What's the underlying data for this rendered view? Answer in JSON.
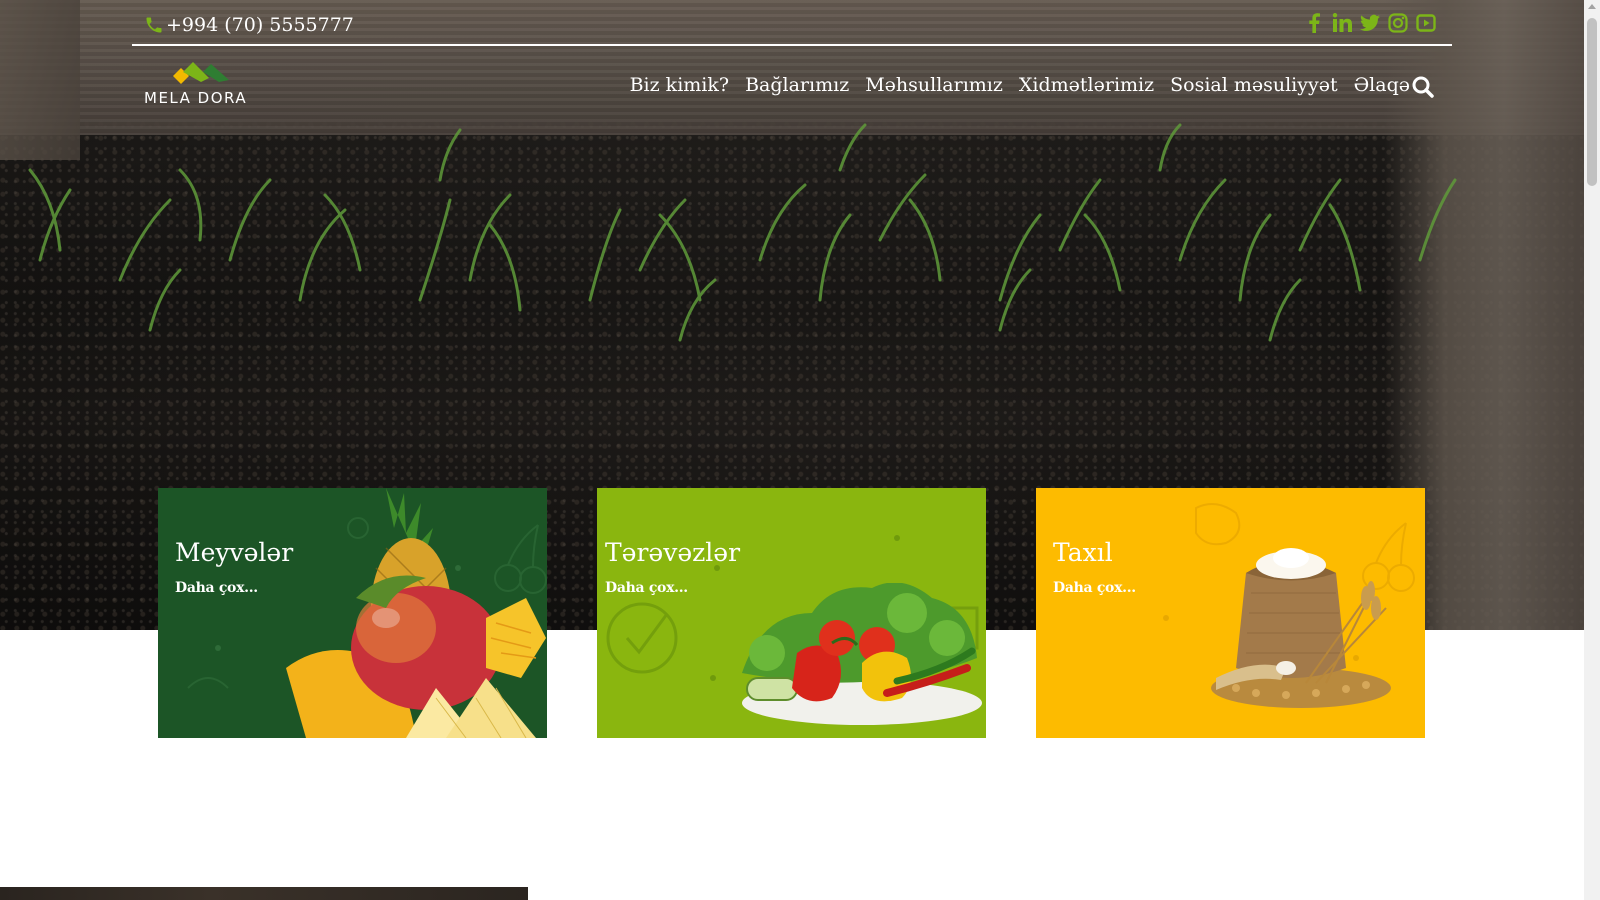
{
  "topbar": {
    "phone": "+994 (70) 5555777",
    "phone_icon": "phone-icon",
    "socials": [
      "facebook-icon",
      "linkedin-icon",
      "twitter-icon",
      "instagram-icon",
      "youtube-icon"
    ]
  },
  "brand": {
    "name": "MELA DORA",
    "accent_green": "#2f7d32",
    "accent_yellow": "#f2b900",
    "icon_color": "#7cb518"
  },
  "nav": {
    "items": [
      {
        "label": "Biz kimik?"
      },
      {
        "label": "Bağlarımız"
      },
      {
        "label": "Məhsullarımız"
      },
      {
        "label": "Xidmətlərimiz"
      },
      {
        "label": "Sosial məsuliyyət"
      },
      {
        "label": "Əlaqə"
      }
    ],
    "search_icon": "search-icon"
  },
  "categories": [
    {
      "title": "Meyvələr",
      "more": "Daha çox...",
      "color": "#1c5526"
    },
    {
      "title": "Tərəvəzlər",
      "more": "Daha çox...",
      "color": "#8ab60f"
    },
    {
      "title": "Taxıl",
      "more": "Daha çox...",
      "color": "#fdbb00"
    }
  ]
}
